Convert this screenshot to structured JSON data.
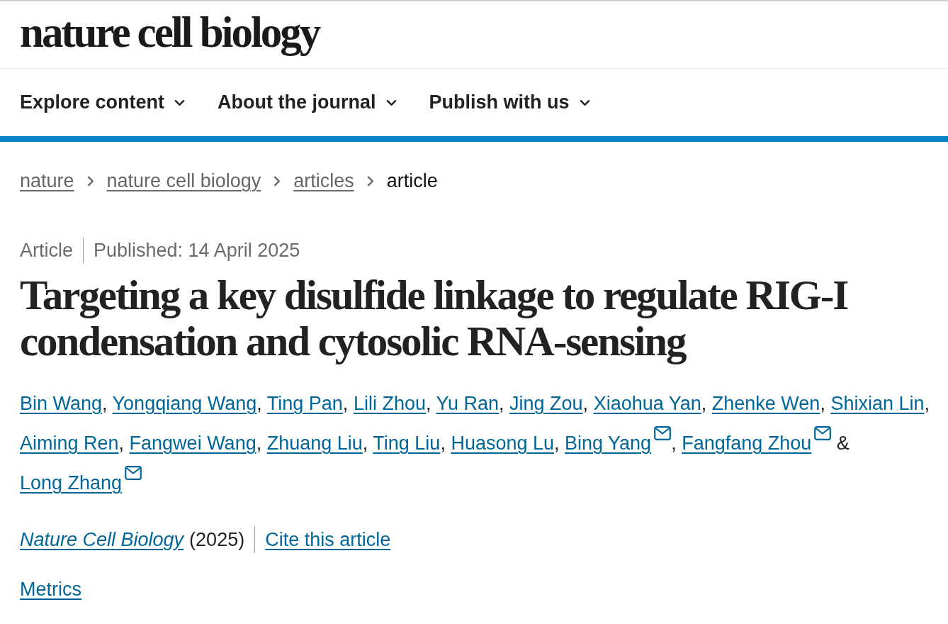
{
  "logo": {
    "text": "nature cell biology"
  },
  "nav": [
    {
      "label": "Explore content"
    },
    {
      "label": "About the journal"
    },
    {
      "label": "Publish with us"
    }
  ],
  "breadcrumbs": [
    {
      "label": "nature",
      "current": false
    },
    {
      "label": "nature cell biology",
      "current": false
    },
    {
      "label": "articles",
      "current": false
    },
    {
      "label": "article",
      "current": true
    }
  ],
  "article": {
    "type": "Article",
    "published": "Published: 14 April 2025",
    "title": "Targeting a key disulfide linkage to regulate RIG-I condensation and cytosolic RNA-sensing",
    "authors": [
      {
        "name": "Bin Wang",
        "corresponding": false,
        "separator": ", "
      },
      {
        "name": "Yongqiang Wang",
        "corresponding": false,
        "separator": ", "
      },
      {
        "name": "Ting Pan",
        "corresponding": false,
        "separator": ", "
      },
      {
        "name": "Lili Zhou",
        "corresponding": false,
        "separator": ", "
      },
      {
        "name": "Yu Ran",
        "corresponding": false,
        "separator": ", "
      },
      {
        "name": "Jing Zou",
        "corresponding": false,
        "separator": ", "
      },
      {
        "name": "Xiaohua Yan",
        "corresponding": false,
        "separator": ", "
      },
      {
        "name": "Zhenke Wen",
        "corresponding": false,
        "separator": ", "
      },
      {
        "name": "Shixian Lin",
        "corresponding": false,
        "separator": ", "
      },
      {
        "name": "Aiming Ren",
        "corresponding": false,
        "separator": ", "
      },
      {
        "name": "Fangwei Wang",
        "corresponding": false,
        "separator": ", "
      },
      {
        "name": "Zhuang Liu",
        "corresponding": false,
        "separator": ", "
      },
      {
        "name": "Ting Liu",
        "corresponding": false,
        "separator": ", "
      },
      {
        "name": "Huasong Lu",
        "corresponding": false,
        "separator": ", "
      },
      {
        "name": "Bing Yang",
        "corresponding": true,
        "separator": ", "
      },
      {
        "name": "Fangfang Zhou",
        "corresponding": true,
        "separator": " & "
      },
      {
        "name": "Long Zhang",
        "corresponding": true
      }
    ],
    "journal": "Nature Cell Biology",
    "year": "(2025)",
    "cite": "Cite this article",
    "metrics": "Metrics"
  }
}
